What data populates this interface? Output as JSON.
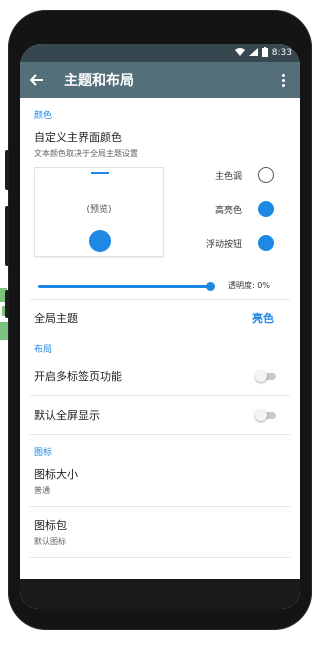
{
  "status_bar": {
    "time": "8:33"
  },
  "toolbar": {
    "title": "主题和布局"
  },
  "color_section": {
    "header": "颜色",
    "custom_title": "自定义主界面颜色",
    "custom_subtitle": "文本颜色取决于全局主题设置",
    "preview_label": "(预览)",
    "swatches": [
      {
        "label": "主色调",
        "color": "#ffffff"
      },
      {
        "label": "高亮色",
        "color": "#1e88e5"
      },
      {
        "label": "浮动按钮",
        "color": "#1e88e5"
      }
    ],
    "transparency_label": "透明度: 0%",
    "accent_color": "#1e88e5",
    "global_theme_label": "全局主题",
    "global_theme_value": "亮色"
  },
  "layout_section": {
    "header": "布局",
    "multi_tab_label": "开启多标签页功能",
    "fullscreen_label": "默认全屏显示"
  },
  "icon_section": {
    "header": "图标",
    "icon_size_title": "图标大小",
    "icon_size_value": "普通",
    "icon_pack_title": "图标包",
    "icon_pack_value": "默认图标"
  }
}
